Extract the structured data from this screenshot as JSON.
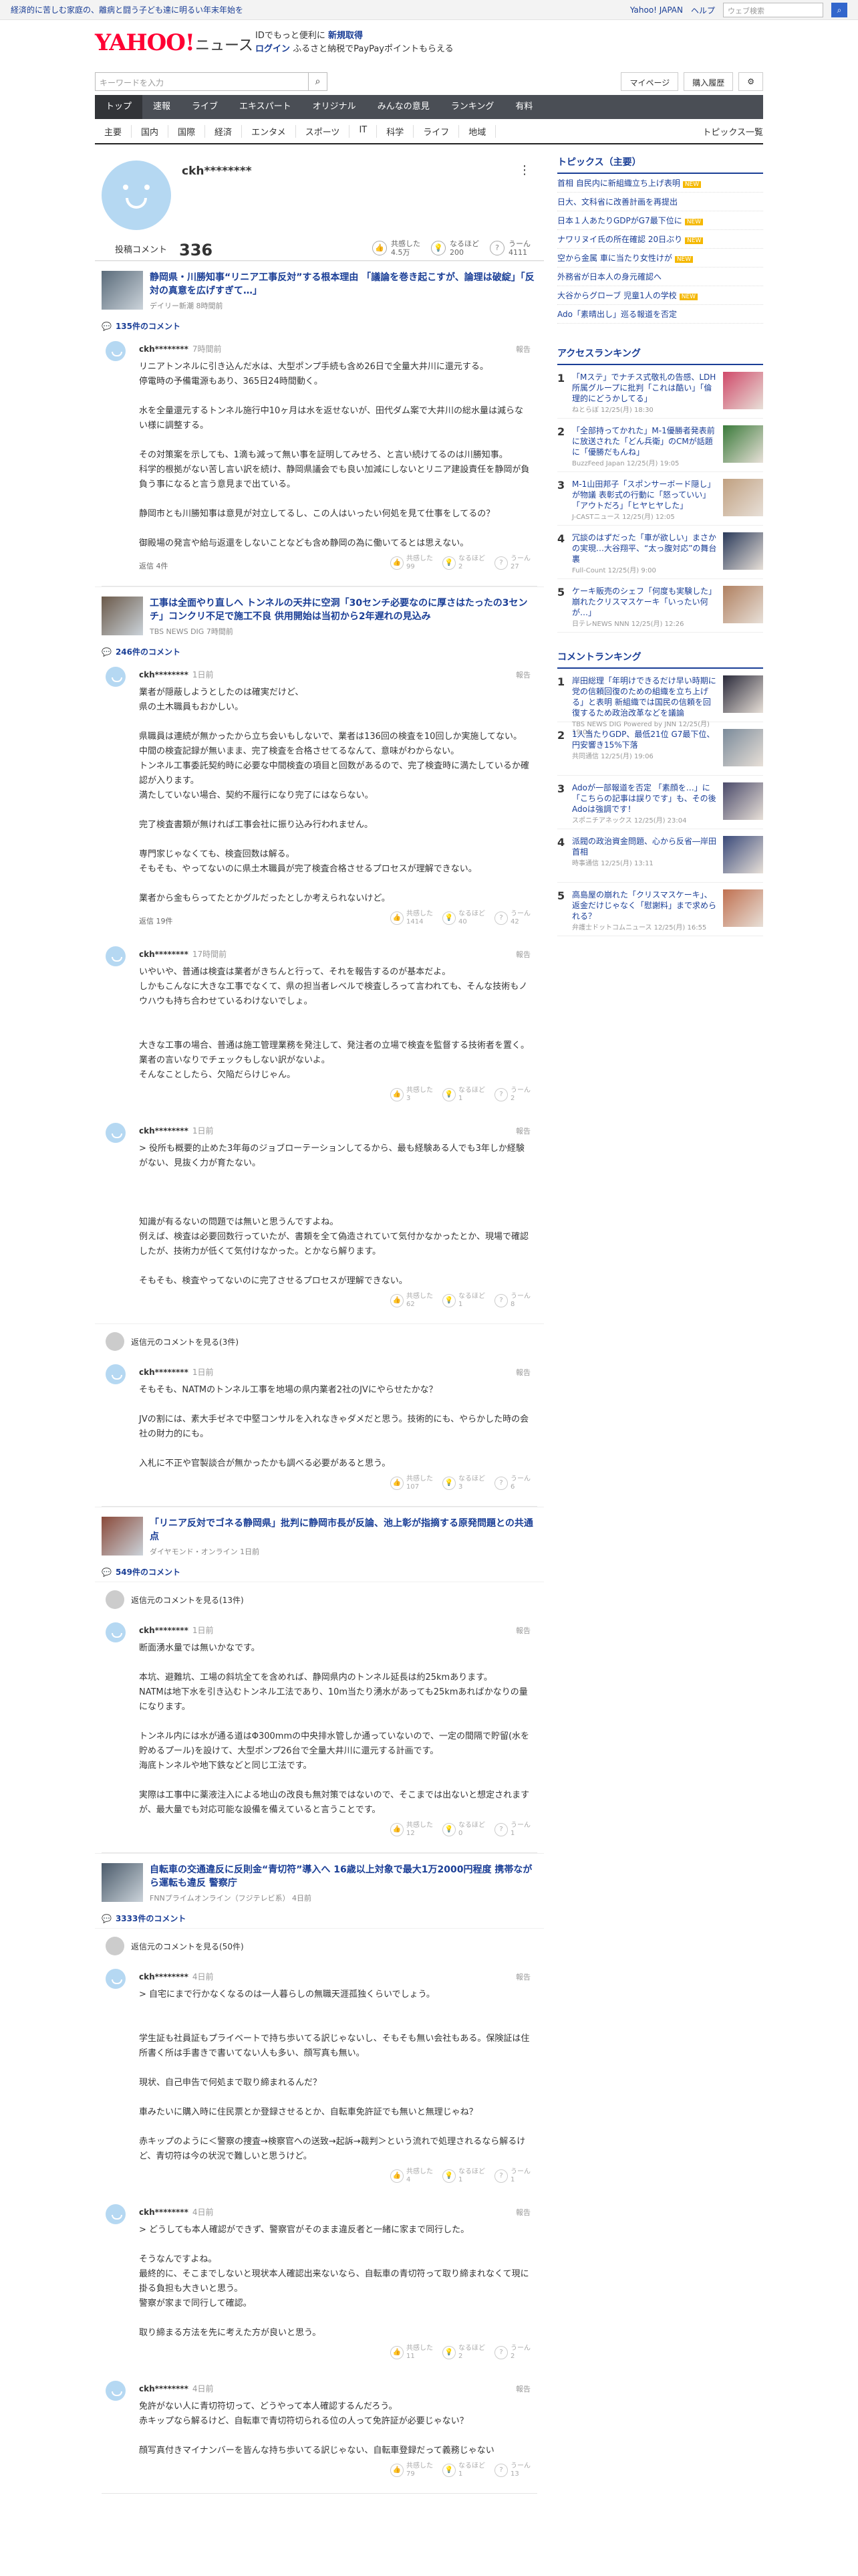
{
  "topbar": {
    "notice": "経済的に苦しむ家庭の、離病と闘う子ども達に明るい年末年始を",
    "yahoo": "Yahoo! JAPAN",
    "help": "ヘルプ",
    "search_placeholder": "ウェブ検索"
  },
  "header": {
    "logo": "YAHOO!",
    "logo_sub": "ニュース",
    "promo_line1": "IDでもっと便利に",
    "promo_line1b": "新規取得",
    "promo_line2a": "ログイン",
    "promo_line2b": "ふるさと納税でPayPayポイントもらえる"
  },
  "util": {
    "search_placeholder": "キーワードを入力",
    "mypage": "マイページ",
    "purchase": "購入履歴"
  },
  "nav": [
    "トップ",
    "速報",
    "ライブ",
    "エキスパート",
    "オリジナル",
    "みんなの意見",
    "ランキング",
    "有料"
  ],
  "subnav": [
    "主要",
    "国内",
    "国際",
    "経済",
    "エンタメ",
    "スポーツ",
    "IT",
    "科学",
    "ライフ",
    "地域"
  ],
  "subnav_all": "トピックス一覧",
  "profile": {
    "name": "ckh********",
    "post_label": "投稿コメント",
    "post_count": "336",
    "empathy_label": "共感した",
    "empathy": "4.5万",
    "naruhodo_label": "なるほど",
    "naruhodo": "200",
    "uun_label": "うーん",
    "uun": "4111"
  },
  "articles": [
    {
      "title": "静岡県・川勝知事“リニア工事反対”する根本理由 「議論を巻き起こすが、論理は破綻」「反対の真意を広げすぎて…」",
      "source": "デイリー新潮  8時間前",
      "count": "135件のコメント",
      "comments": [
        {
          "user": "ckh********",
          "time": "7時間前",
          "body": "リニアトンネルに引き込んだ水は、大型ポンプ手続も含め26日で全量大井川に還元する。\n停電時の予備電源もあり、365日24時間動く。\n\n水を全量還元するトンネル施行中10ヶ月は水を返せないが、田代ダム案で大井川の総水量は減らない様に調整する。\n\nその対策案を示しても、1滴も減って無い事を証明してみせろ、と言い続けてるのは川勝知事。\n科学的根拠がない苦し言い訳を続け、静岡県議会でも良い加減にしないとリニア建設責任を静岡が負負う事になると言う意見まで出ている。\n\n静岡市とも川勝知事は意見が対立してるし、この人はいったい何処を見て仕事をしてるの？\n\n御殿場の発言や給与返還をしないことなども含め静岡の為に働いてるとは思えない。",
          "reply": "返信 4件",
          "r1": "99",
          "r2": "2",
          "r3": "27"
        }
      ]
    },
    {
      "title": "工事は全面やり直しへ トンネルの天井に空洞「30センチ必要なのに厚さはたったの3センチ」コンクリ不足で施工不良 供用開始は当初から2年遅れの見込み",
      "source": "TBS NEWS DIG  7時間前",
      "count": "246件のコメント",
      "comments": [
        {
          "user": "ckh********",
          "time": "1日前",
          "body": "業者が隠蔽しようとしたのは確実だけど、\n県の土木職員もおかしい。\n\n県職員は連続が無かったから立ち会いもしないで、業者は136回の検査を10回しか実施してない。中間の検査記録が無いまま、完了検査を合格させてるなんて、意味がわからない。\nトンネル工事委託契約時に必要な中間検査の項目と回数があるので、完了検査時に満たしているか確認が入ります。\n満たしていない場合、契約不履行になり完了にはならない。\n\n完了検査書類が無ければ工事会社に振り込み行われません。\n\n専門家じゃなくても、検査回数は解る。\nそもそも、やってないのに県土木職員が完了検査合格させるプロセスが理解できない。\n\n業者から金もらってたとかグルだったとしか考えられないけど。",
          "reply": "返信 19件",
          "r1": "1414",
          "r2": "40",
          "r3": "42"
        },
        {
          "user": "ckh********",
          "time": "17時間前",
          "body": "いやいや、普通は検査は業者がきちんと行って、それを報告するのが基本だよ。\nしかもこんなに大きな工事でなくて、県の担当者レベルで検査しろって言われても、そんな技術もノウハウも持ち合わせているわけないでしょ。\n\n\n大きな工事の場合、普通は施工管理業務を発注して、発注者の立場で検査を監督する技術者を置く。\n業者の言いなりでチェックもしない訳がないよ。\nそんなことしたら、欠陥だらけじゃん。",
          "reply": "",
          "r1": "3",
          "r2": "1",
          "r3": "2"
        },
        {
          "user": "ckh********",
          "time": "1日前",
          "body": "> 役所も概要的止めた3年毎のジョブローテーションしてるから、最も経験ある人でも3年しか経験がない、見抜く力が育たない。\n\n\n\n知識が有るないの問題では無いと思うんですよね。\n例えば、検査は必要回数行っていたが、書類を全て偽造されていて気付かなかったとか、現場で確認したが、技術力が低くて気付けなかった。とかなら解ります。\n\nそもそも、検査やってないのに完了させるプロセスが理解できない。",
          "reply": "",
          "r1": "62",
          "r2": "1",
          "r3": "8"
        }
      ],
      "prev": "返信元のコメントを見る(3件)",
      "comments2": [
        {
          "user": "ckh********",
          "time": "1日前",
          "body": "そもそも、NATMのトンネル工事を地場の県内業者2社のJVにやらせたかな？\n\nJVの割には、素大手ゼネで中堅コンサルを入れなきゃダメだと思う。技術的にも、やらかした時の会社の財力的にも。\n\n入札に不正や官製談合が無かったかも調べる必要があると思う。",
          "reply": "",
          "r1": "107",
          "r2": "3",
          "r3": "6"
        }
      ]
    },
    {
      "title": "「リニア反対でゴネる静岡県」批判に静岡市長が反論、池上彰が指摘する原発問題との共通点",
      "source": "ダイヤモンド・オンライン  1日前",
      "count": "549件のコメント",
      "prev": "返信元のコメントを見る(13件)",
      "comments": [
        {
          "user": "ckh********",
          "time": "1日前",
          "body": "断面湧水量では無いかなです。\n\n本坑、避難坑、工場の斜坑全てを含めれば、静岡県内のトンネル延長は約25kmあります。\nNATMは地下水を引き込むトンネル工法であり、10m当たり湧水があっても25kmあればかなりの量になります。\n\nトンネル内には水が通る道はΦ300mmの中央排水管しか通っていないので、一定の間隔で貯留(水を貯めるプール)を設けて、大型ポンプ26台で全量大井川に還元する計画です。\n海底トンネルや地下鉄などと同じ工法です。\n\n実際は工事中に薬液注入による地山の改良も無対策ではないので、そこまでは出ないと想定されますが、最大量でも対応可能な設備を備えていると言うことです。",
          "reply": "",
          "r1": "12",
          "r2": "0",
          "r3": "1"
        }
      ]
    },
    {
      "title": "自転車の交通違反に反則金“青切符”導入へ 16歳以上対象で最大1万2000円程度 携帯ながら運転も違反 警察庁",
      "source": "FNNプライムオンライン（フジテレビ系）  4日前",
      "count": "3333件のコメント",
      "prev": "返信元のコメントを見る(50件)",
      "comments": [
        {
          "user": "ckh********",
          "time": "4日前",
          "body": "> 自宅にまで行かなくなるのは一人暮らしの無職天涯孤独くらいでしょう。\n\n\n学生証も社員証もプライベートで持ち歩いてる訳じゃないし、そもそも無い会社もある。保険証は住所書く所は手書きで書いてない人も多い、顔写真も無い。\n\n現状、自己申告で何処まで取り締まれるんだ？\n\n車みたいに購入時に住民票とか登録させるとか、自転車免許証でも無いと無理じゃね？\n\n赤キップのように＜警察の捜査→検察官への送致→起訴→裁判＞という流れで処理されるなら解るけど、青切符は今の状況で難しいと思うけど。",
          "reply": "",
          "r1": "4",
          "r2": "1",
          "r3": "1"
        },
        {
          "user": "ckh********",
          "time": "4日前",
          "body": "> どうしても本人確認ができず、警察官がそのまま違反者と一緒に家まで同行した。\n\nそうなんですよね。\n最終的に、そこまでしないと現状本人確認出来ないなら、自転車の青切符って取り締まれなくて現に掛る負担も大きいと思う。\n警察が家まで同行して確認。\n\n取り締まる方法を先に考えた方が良いと思う。",
          "reply": "",
          "r1": "11",
          "r2": "2",
          "r3": "2"
        },
        {
          "user": "ckh********",
          "time": "4日前",
          "body": "免許がない人に青切符切って、どうやって本人確認するんだろう。\n赤キップなら解るけど、自転車で青切符切られる位の人って免許証が必要じゃない？\n\n顔写真付きマイナンバーを皆んな持ち歩いてる訳じゃない、自転車登録だって義務じゃない",
          "reply": "",
          "r1": "79",
          "r2": "1",
          "r3": "13"
        }
      ]
    }
  ],
  "side": {
    "topics_head": "トピックス（主要）",
    "topics": [
      "首相 自民内に新組織立ち上げ表明",
      "日大、文科省に改善計画を再提出",
      "日本１人あたりGDPがG7最下位に",
      "ナワリヌイ氏の所在確認 20日ぶり",
      "空から金属 車に当たり女性けが",
      "外務省が日本人の身元確認へ",
      "大谷からグローブ 児童1人の学校",
      "Ado「素晴出し」巡る報道を否定"
    ],
    "access_head": "アクセスランキング",
    "access": [
      {
        "title": "「Mステ」でナチス式敬礼の告感、LDH所属グループに批判「これは酷い」「倫理的にどうかしてる」",
        "src": "ねとらぼ 12/25(月) 18:30"
      },
      {
        "title": "「全部持ってかれた」M-1優勝者発表前に放送された「どん兵衛」のCMが話題に「優勝だもんね」",
        "src": "BuzzFeed Japan 12/25(月) 19:05"
      },
      {
        "title": "M-1山田邦子「スポンサーボード隠し」が物議 表彰式の行動に「怒っていい」「アウトだろ」「ヒヤヒヤした」",
        "src": "J-CASTニュース 12/25(月) 12:05"
      },
      {
        "title": "冗談のはずだった「車が欲しい」まさかの実現…大谷翔平、“太っ腹対応”の舞台裏",
        "src": "Full-Count 12/25(月) 9:00"
      },
      {
        "title": "ケーキ販売のシェフ「何度も実験した」 崩れたクリスマスケーキ「いったい何が…」",
        "src": "日テレNEWS NNN 12/25(月) 12:26"
      }
    ],
    "comment_head": "コメントランキング",
    "comment_rank": [
      {
        "title": "岸田総理「年明けできるだけ早い時期に党の信頼回復のための組織を立ち上げる」と表明 新組織では国民の信頼を回復するため政治改革などを議論",
        "src": "TBS NEWS DIG Powered by JNN 12/25(月) 19:06"
      },
      {
        "title": "1人当たりGDP、最低21位 G7最下位、円安響き15%下落",
        "src": "共同通信 12/25(月) 19:06"
      },
      {
        "title": "Adoが一部報道を否定 「素顔を…」に「こちらの記事は誤りです」も、その後Adoは強調です！",
        "src": "スポニチアネックス 12/25(月) 23:04"
      },
      {
        "title": "派閥の政治資金問題、心から反省―岸田首相",
        "src": "時事通信 12/25(月) 13:11"
      },
      {
        "title": "高島屋の崩れた「クリスマスケーキ」、返金だけじゃなく「慰謝料」まで求められる？",
        "src": "弁護士ドットコムニュース 12/25(月) 16:55"
      }
    ]
  },
  "colors": {
    "brand_red": "#ff0033",
    "link_blue": "#1a3e96",
    "nav_dark": "#4a4e55"
  }
}
